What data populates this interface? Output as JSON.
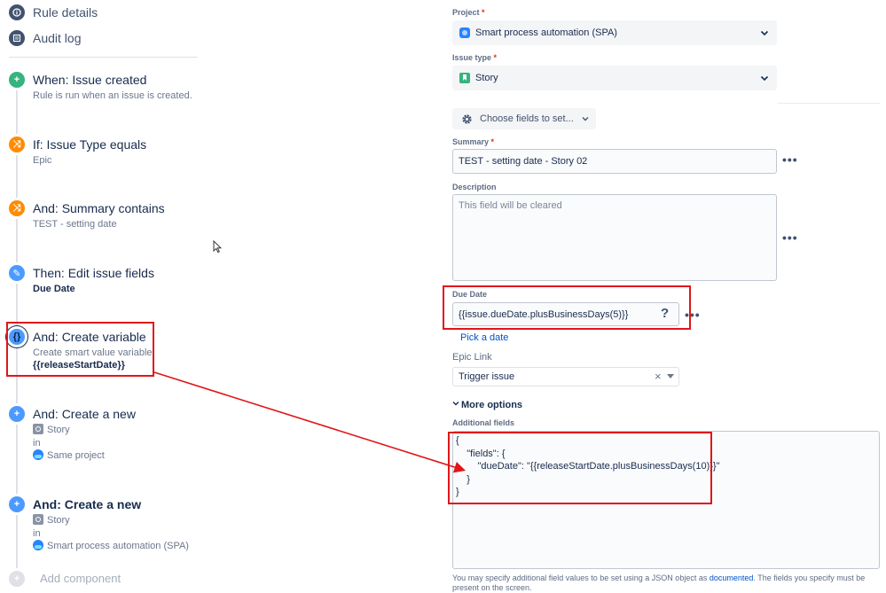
{
  "nav": {
    "rule_details": "Rule details",
    "audit_log": "Audit log"
  },
  "components": [
    {
      "title": "When: Issue created",
      "sub1": "Rule is run when an issue is created.",
      "color": "#36b37e"
    },
    {
      "title": "If: Issue Type equals",
      "sub1": "Epic",
      "color": "#ff8b00"
    },
    {
      "title": "And: Summary contains",
      "sub1": "TEST - setting date",
      "color": "#ff8b00"
    },
    {
      "title": "Then: Edit issue fields",
      "sub1": "Due Date",
      "color": "#4c9aff"
    },
    {
      "title": "And: Create variable",
      "sub1": "Create smart value variable",
      "sub2": "{{releaseStartDate}}",
      "color": "#4c9aff"
    },
    {
      "title": "And: Create a new",
      "item": "Story",
      "in": "in",
      "project": "Same project",
      "color": "#4c9aff"
    },
    {
      "title": "And: Create a new",
      "item": "Story",
      "in": "in",
      "project": "Smart process automation (SPA)",
      "color": "#4c9aff"
    }
  ],
  "add_component": "Add component",
  "form": {
    "project_label": "Project",
    "project_value": "Smart process automation (SPA)",
    "issue_type_label": "Issue type",
    "issue_type_value": "Story",
    "choose_fields": "Choose fields to set...",
    "summary_label": "Summary",
    "summary_value": "TEST - setting date - Story 02",
    "description_label": "Description",
    "description_placeholder": "This field will be cleared",
    "due_date_label": "Due Date",
    "due_date_value": "{{issue.dueDate.plusBusinessDays(5)}}",
    "pick_date": "Pick a date",
    "epic_link_label": "Epic Link",
    "epic_link_value": "Trigger issue",
    "more_options": "More options",
    "additional_fields_label": "Additional fields",
    "json_lines": [
      "{",
      "    \"fields\": {",
      "        \"dueDate\": \"{{releaseStartDate.plusBusinessDays(10)}}\"",
      "    }",
      "}"
    ],
    "footer_pre": "You may specify additional field values to be set using a JSON object as ",
    "footer_link": "documented",
    "footer_post": ". The fields you specify must be present on the screen.",
    "help_glyph": "?",
    "clear_glyph": "×"
  },
  "colors": {
    "annotation": "#e0161a",
    "link": "#0052cc"
  }
}
